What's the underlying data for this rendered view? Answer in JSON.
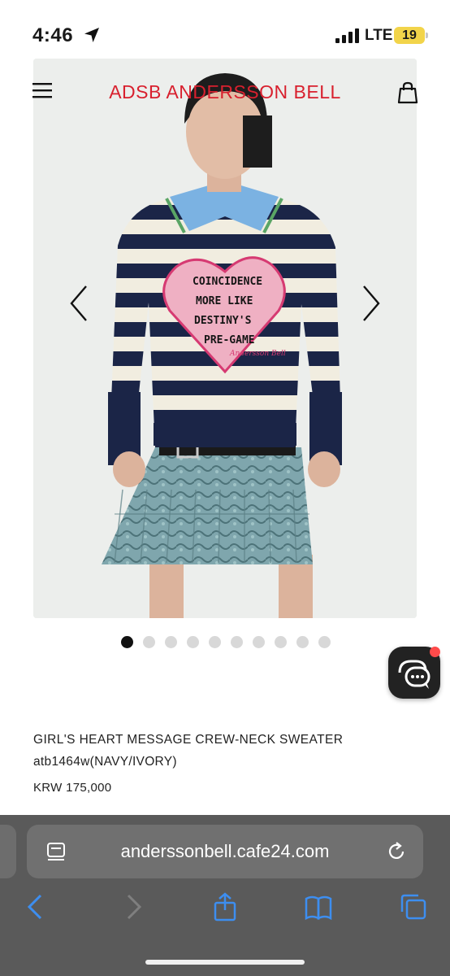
{
  "status_bar": {
    "time": "4:46",
    "network": "LTE",
    "battery": "19"
  },
  "header": {
    "brand": "ADSB ANDERSSON BELL",
    "brand_color": "#d8202e",
    "menu_icon": "hamburger-menu-icon",
    "cart_icon": "shopping-bag-icon"
  },
  "gallery": {
    "total_slides": 10,
    "active_index": 0,
    "prev_icon": "chevron-left-icon",
    "next_icon": "chevron-right-icon",
    "sweater_text": [
      "COINCIDENCE",
      "MORE LIKE",
      "DESTINY'S",
      "PRE-GAME"
    ],
    "sweater_signature": "Andersson Bell"
  },
  "chat": {
    "icon": "chat-bubble-icon",
    "has_notification": true
  },
  "product": {
    "name": "GIRL'S HEART MESSAGE CREW-NECK SWEATER",
    "code": "atb1464w(NAVY/IVORY)",
    "price": "KRW 175,000"
  },
  "browser": {
    "url": "anderssonbell.cafe24.com",
    "reader_icon": "reader-mode-icon",
    "reload_icon": "reload-icon",
    "back_icon": "back-arrow-icon",
    "forward_icon": "forward-arrow-icon",
    "share_icon": "share-icon",
    "bookmarks_icon": "bookmarks-icon",
    "tabs_icon": "tabs-icon"
  }
}
